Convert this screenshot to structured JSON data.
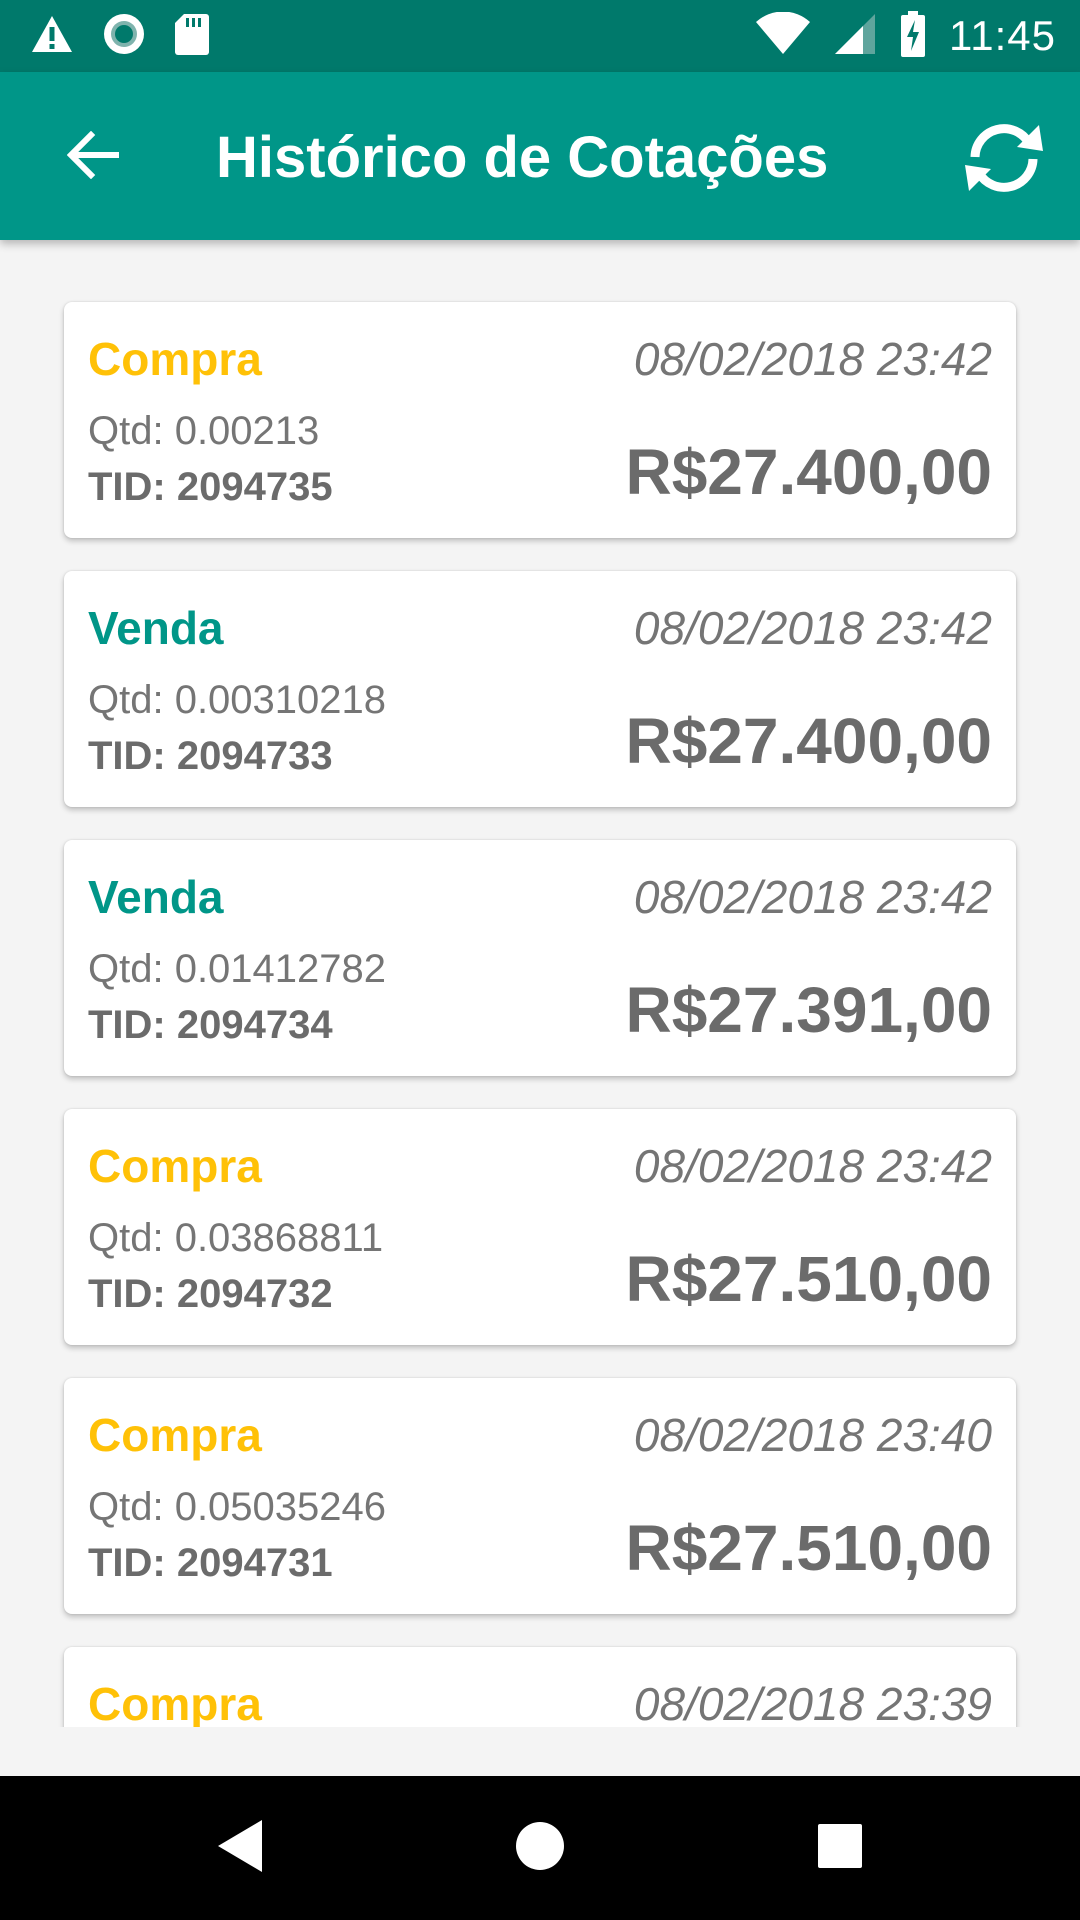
{
  "status_bar": {
    "time": "11:45",
    "left_icons": [
      "warning-icon",
      "circle-app-icon",
      "sd-card-icon"
    ],
    "right_icons": [
      "wifi-icon",
      "cell-signal-icon",
      "battery-charging-icon"
    ],
    "background": "#00796b"
  },
  "app_bar": {
    "title": "Histórico de Cotações",
    "back_icon": "arrow-left-icon",
    "refresh_icon": "refresh-icon",
    "background": "#009688"
  },
  "colors": {
    "compra": "#ffc107",
    "venda": "#009688",
    "text_secondary": "#757575"
  },
  "trades": [
    {
      "type": "Compra",
      "kind": "compra",
      "date": "08/02/2018 23:42",
      "qtd": "Qtd: 0.00213",
      "tid": "TID: 2094735",
      "price": "R$27.400,00"
    },
    {
      "type": "Venda",
      "kind": "venda",
      "date": "08/02/2018 23:42",
      "qtd": "Qtd: 0.00310218",
      "tid": "TID: 2094733",
      "price": "R$27.400,00"
    },
    {
      "type": "Venda",
      "kind": "venda",
      "date": "08/02/2018 23:42",
      "qtd": "Qtd: 0.01412782",
      "tid": "TID: 2094734",
      "price": "R$27.391,00"
    },
    {
      "type": "Compra",
      "kind": "compra",
      "date": "08/02/2018 23:42",
      "qtd": "Qtd: 0.03868811",
      "tid": "TID: 2094732",
      "price": "R$27.510,00"
    },
    {
      "type": "Compra",
      "kind": "compra",
      "date": "08/02/2018 23:40",
      "qtd": "Qtd: 0.05035246",
      "tid": "TID: 2094731",
      "price": "R$27.510,00"
    },
    {
      "type": "Compra",
      "kind": "compra",
      "date": "08/02/2018 23:39",
      "qtd": "",
      "tid": "",
      "price": ""
    }
  ],
  "nav_bar": {
    "buttons": [
      "back-triangle-icon",
      "home-circle-icon",
      "recents-square-icon"
    ]
  }
}
